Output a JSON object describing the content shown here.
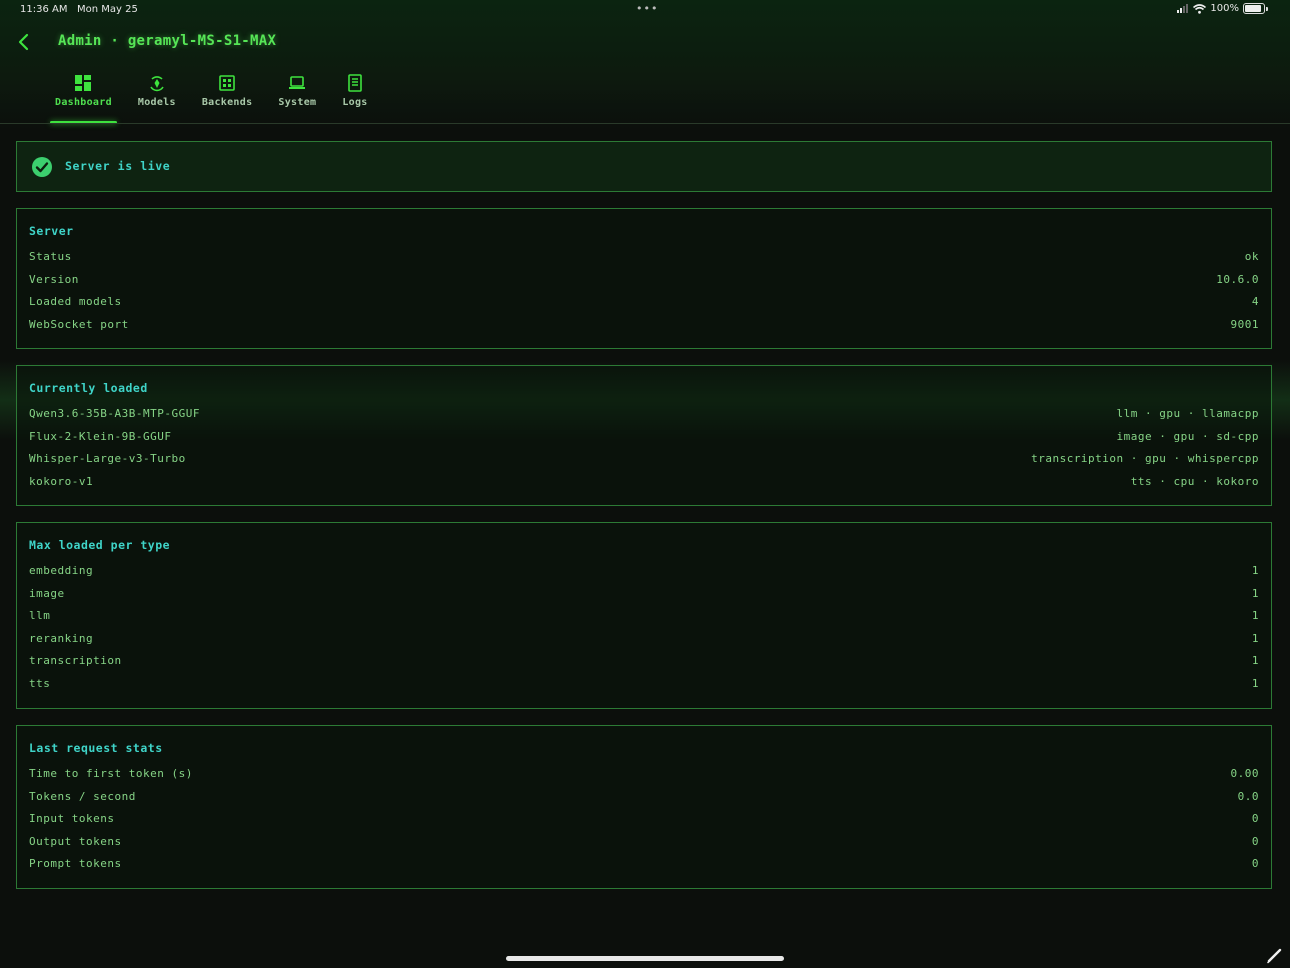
{
  "status_bar": {
    "time": "11:36 AM",
    "date": "Mon May 25",
    "dots": "•••",
    "battery": "100%",
    "battery_level": 1.0
  },
  "header": {
    "title": "Admin · geramyl-MS-S1-MAX",
    "back_icon": "chevron-left-icon"
  },
  "tabs": [
    {
      "label": "Dashboard",
      "icon": "dashboard-grid-icon",
      "active": true
    },
    {
      "label": "Models",
      "icon": "models-icon",
      "active": false
    },
    {
      "label": "Backends",
      "icon": "backends-icon",
      "active": false
    },
    {
      "label": "System",
      "icon": "laptop-icon",
      "active": false
    },
    {
      "label": "Logs",
      "icon": "logs-icon",
      "active": false
    }
  ],
  "live_banner": {
    "text": "Server is live",
    "icon": "check-circle-icon"
  },
  "server": {
    "title": "Server",
    "rows": [
      {
        "key": "Status",
        "value": "ok"
      },
      {
        "key": "Version",
        "value": "10.6.0"
      },
      {
        "key": "Loaded models",
        "value": "4"
      },
      {
        "key": "WebSocket port",
        "value": "9001"
      }
    ]
  },
  "currently_loaded": {
    "title": "Currently loaded",
    "rows": [
      {
        "key": "Qwen3.6-35B-A3B-MTP-GGUF",
        "value": "llm · gpu · llamacpp"
      },
      {
        "key": "Flux-2-Klein-9B-GGUF",
        "value": "image · gpu · sd-cpp"
      },
      {
        "key": "Whisper-Large-v3-Turbo",
        "value": "transcription · gpu · whispercpp"
      },
      {
        "key": "kokoro-v1",
        "value": "tts · cpu · kokoro"
      }
    ]
  },
  "max_loaded": {
    "title": "Max loaded per type",
    "rows": [
      {
        "key": "embedding",
        "value": "1"
      },
      {
        "key": "image",
        "value": "1"
      },
      {
        "key": "llm",
        "value": "1"
      },
      {
        "key": "reranking",
        "value": "1"
      },
      {
        "key": "transcription",
        "value": "1"
      },
      {
        "key": "tts",
        "value": "1"
      }
    ]
  },
  "last_request": {
    "title": "Last request stats",
    "rows": [
      {
        "key": "Time to first token (s)",
        "value": "0.00"
      },
      {
        "key": "Tokens / second",
        "value": "0.0"
      },
      {
        "key": "Input tokens",
        "value": "0"
      },
      {
        "key": "Output tokens",
        "value": "0"
      },
      {
        "key": "Prompt tokens",
        "value": "0"
      }
    ]
  },
  "colors": {
    "accent": "#3ee33e",
    "heading": "#3fd4c8",
    "text": "#86d486",
    "border": "#2c7a35",
    "background": "#0c0f0c"
  }
}
